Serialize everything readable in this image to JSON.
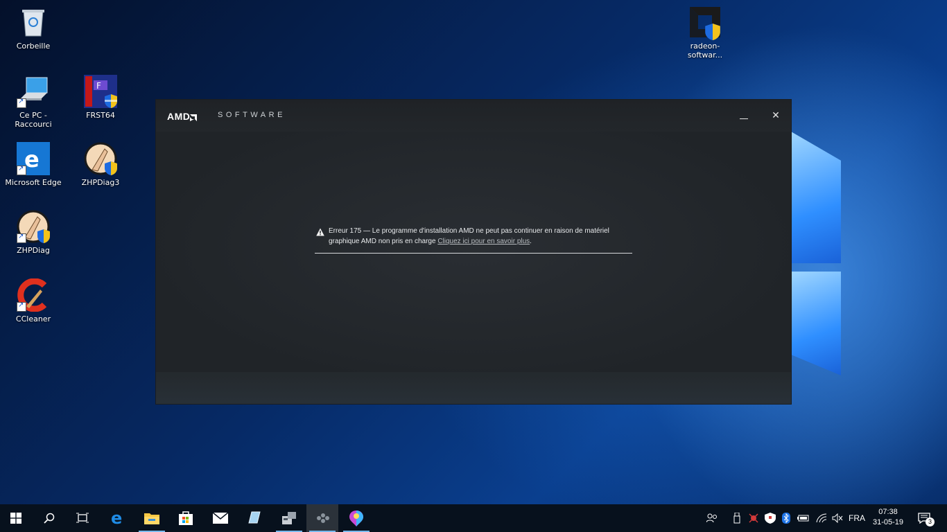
{
  "desktop": {
    "icons": [
      {
        "label": "Corbeille"
      },
      {
        "label": "Ce PC -\nRaccourci"
      },
      {
        "label": "FRST64"
      },
      {
        "label": "Microsoft Edge"
      },
      {
        "label": "ZHPDiag3"
      },
      {
        "label": "ZHPDiag"
      },
      {
        "label": "CCleaner"
      },
      {
        "label": "radeon-softwar..."
      }
    ]
  },
  "amd_window": {
    "logo_text": "AMD",
    "brand": "SOFTWARE",
    "close_glyph": "✕",
    "error_text": "Erreur 175 — Le programme d'installation AMD ne peut pas continuer en raison de matériel graphique AMD non pris en charge ",
    "error_link": "Cliquez ici pour en savoir plus",
    "error_end": "."
  },
  "taskbar": {
    "language": "FRA",
    "time": "07:38",
    "date": "31-05-19",
    "notification_count": "3",
    "pinned": [
      "start-icon",
      "search-icon",
      "task-view-icon",
      "edge-icon",
      "file-explorer-icon",
      "store-icon",
      "mail-icon",
      "app-icon",
      "app-icon-2",
      "amd-icon",
      "paint-icon"
    ]
  },
  "colors": {
    "amd_bg": "#23272b",
    "taskbar_bg": "#07111d",
    "active_underline": "#76b9ed"
  }
}
